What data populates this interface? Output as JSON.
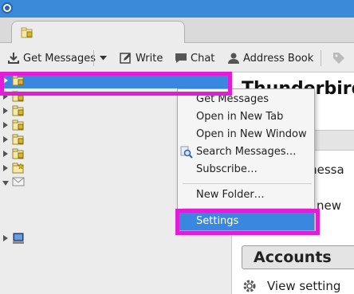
{
  "toolbar": {
    "get_messages": "Get Messages",
    "write": "Write",
    "chat": "Chat",
    "address_book": "Address Book"
  },
  "content": {
    "title_fragment": "Thunderbird",
    "line1": "messa",
    "line2": "a new",
    "accounts_heading": "Accounts",
    "view_settings": "View setting"
  },
  "context_menu": {
    "items": [
      {
        "label": "Get Messages"
      },
      {
        "label": "Open in New Tab"
      },
      {
        "label": "Open in New Window"
      },
      {
        "label": "Search Messages…"
      },
      {
        "label": "Subscribe…"
      },
      {
        "label": "New Folder…"
      },
      {
        "label": "Settings"
      }
    ]
  },
  "colors": {
    "selection": "#3a87e0",
    "highlight_box": "#e11ed6",
    "titlebar": "#3b8ad9"
  }
}
